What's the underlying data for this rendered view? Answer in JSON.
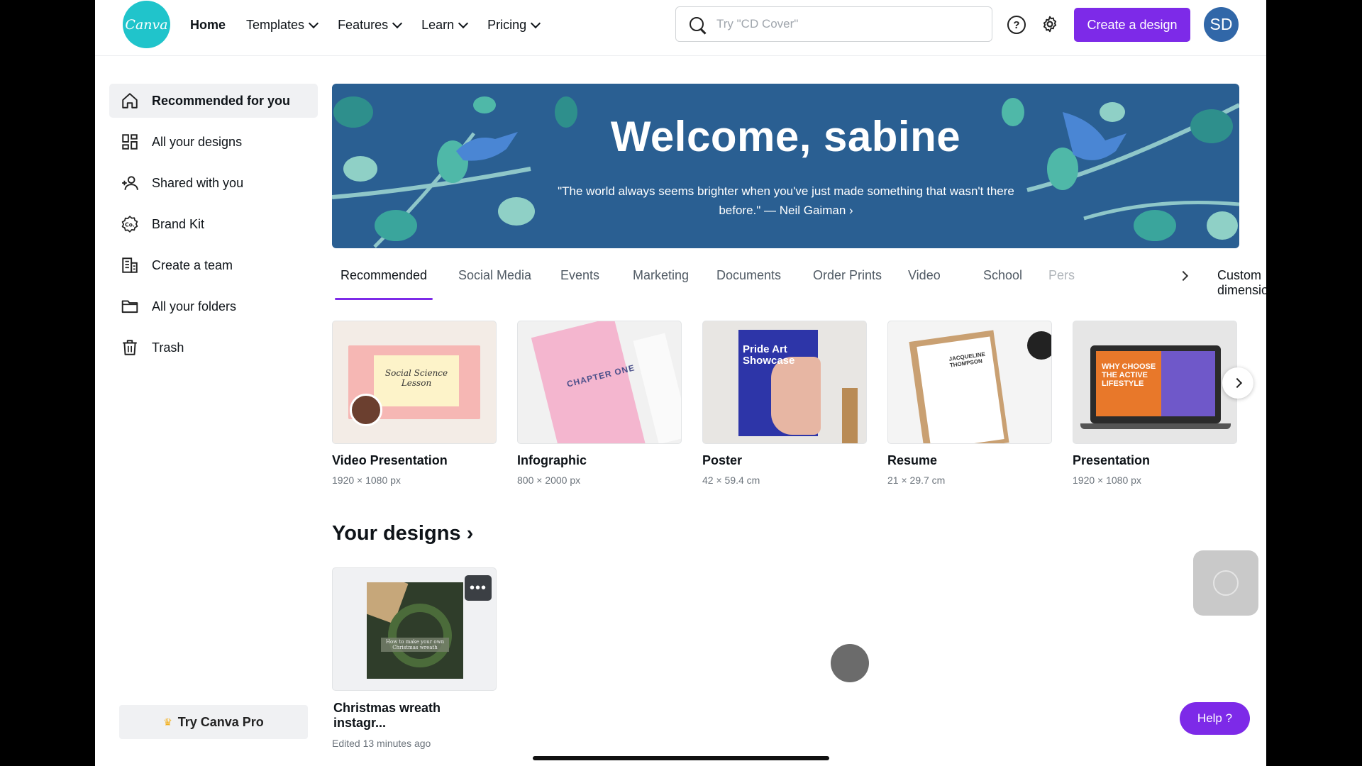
{
  "header": {
    "logo_text": "Canva",
    "nav": [
      {
        "label": "Home",
        "active": true,
        "dropdown": false
      },
      {
        "label": "Templates",
        "dropdown": true
      },
      {
        "label": "Features",
        "dropdown": true
      },
      {
        "label": "Learn",
        "dropdown": true
      },
      {
        "label": "Pricing",
        "dropdown": true
      }
    ],
    "search_placeholder": "Try \"CD Cover\"",
    "help_glyph": "?",
    "create_label": "Create a design",
    "avatar_initials": "SD"
  },
  "sidebar": {
    "items": [
      {
        "label": "Recommended for you",
        "icon": "home-icon",
        "active": true
      },
      {
        "label": "All your designs",
        "icon": "grid-icon"
      },
      {
        "label": "Shared with you",
        "icon": "people-icon"
      },
      {
        "label": "Brand Kit",
        "icon": "brand-kit-icon"
      },
      {
        "label": "Create a team",
        "icon": "building-icon"
      },
      {
        "label": "All your folders",
        "icon": "folder-icon"
      },
      {
        "label": "Trash",
        "icon": "trash-icon"
      }
    ],
    "pro_label": "Try Canva Pro"
  },
  "banner": {
    "title": "Welcome, sabine",
    "quote": "\"The world always seems brighter when you've just made something that wasn't there before.\" — Neil Gaiman ›"
  },
  "tabs": [
    {
      "label": "Recommended",
      "active": true
    },
    {
      "label": "Social Media"
    },
    {
      "label": "Events"
    },
    {
      "label": "Marketing"
    },
    {
      "label": "Documents"
    },
    {
      "label": "Order Prints"
    },
    {
      "label": "Video"
    },
    {
      "label": "School"
    },
    {
      "label": "Pers"
    }
  ],
  "custom_dimensions": "Custom dimensions",
  "templates": [
    {
      "title": "Video Presentation",
      "size": "1920 × 1080 px",
      "thumb_text": "Social Science Lesson"
    },
    {
      "title": "Infographic",
      "size": "800 × 2000 px",
      "thumb_text": "CHAPTER ONE"
    },
    {
      "title": "Poster",
      "size": "42 × 59.4 cm",
      "thumb_text": "Pride Art Showcase"
    },
    {
      "title": "Resume",
      "size": "21 × 29.7 cm",
      "thumb_text": "JACQUELINE THOMPSON"
    },
    {
      "title": "Presentation",
      "size": "1920 × 1080 px",
      "thumb_text": "WHY CHOOSE THE ACTIVE LIFESTYLE"
    }
  ],
  "your_designs": {
    "heading": "Your designs ›",
    "items": [
      {
        "title": "Christmas wreath instagr...",
        "edited": "Edited 13 minutes ago",
        "thumb_text": "How to make your own Christmas wreath"
      }
    ]
  },
  "help_button": "Help  ?",
  "colors": {
    "brand_purple": "#7d2ae8",
    "logo_teal": "#20c4cb",
    "banner_blue": "#2a5f92",
    "avatar_blue": "#3167a8"
  }
}
